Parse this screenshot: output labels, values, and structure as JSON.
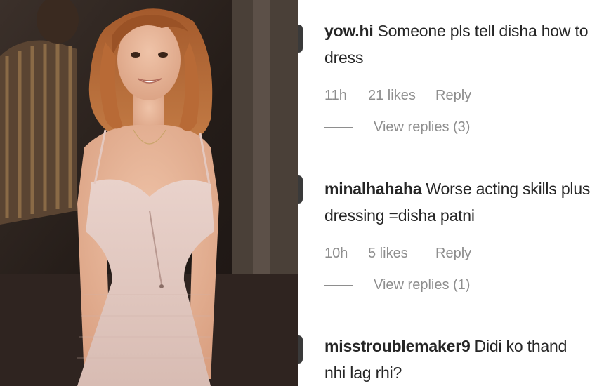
{
  "comments": [
    {
      "username": "yow.hi",
      "text": "Someone pls tell disha how to dress",
      "time": "11h",
      "likes": "21 likes",
      "reply": "Reply",
      "view_replies": "View replies (3)"
    },
    {
      "username": "minalhahaha",
      "text": "Worse acting skills plus dressing =disha patni",
      "time": "10h",
      "likes": "5 likes",
      "reply": "Reply",
      "view_replies": "View replies (1)"
    },
    {
      "username": "misstroublemaker9",
      "text": "Didi ko thand nhi lag rhi?"
    }
  ]
}
